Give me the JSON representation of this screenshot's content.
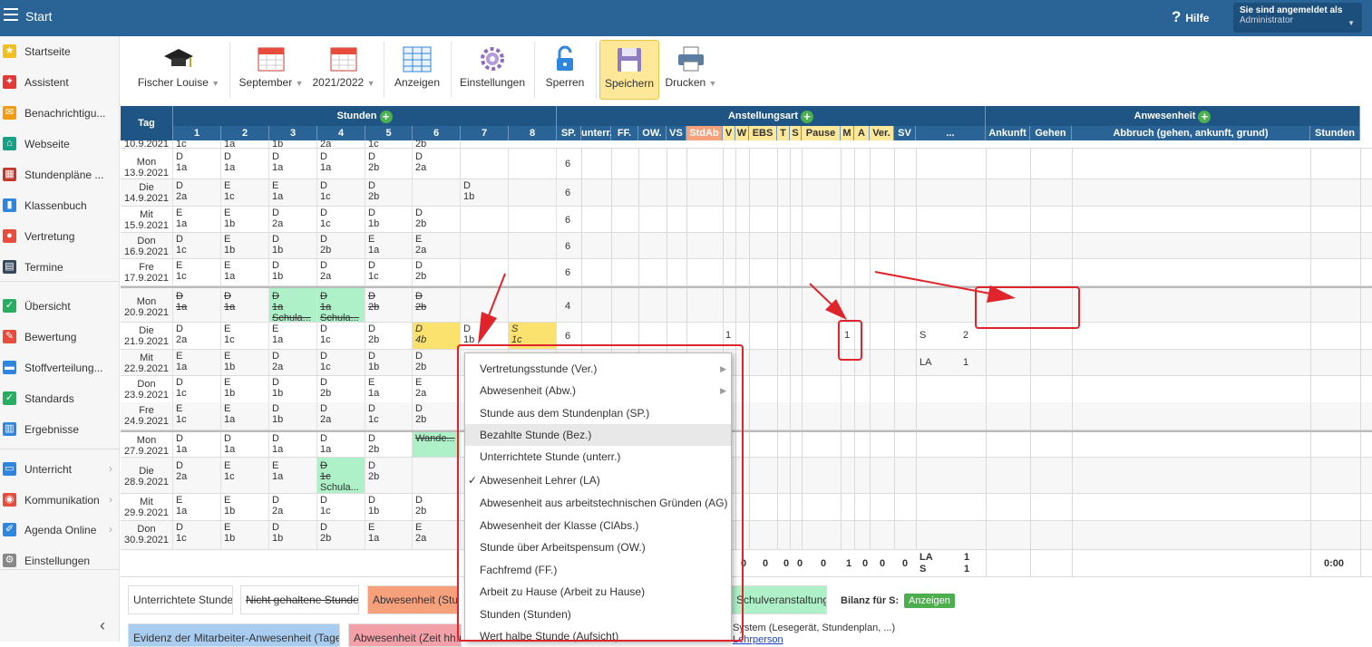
{
  "header": {
    "title": "Start",
    "help": "Hilfe",
    "user_label": "Sie sind angemeldet als",
    "user_role": "Administrator"
  },
  "sidebar": [
    {
      "label": "Startseite",
      "icon": "star-icon",
      "color": "#f0c020",
      "glyph": "★"
    },
    {
      "label": "Assistent",
      "icon": "wand-icon",
      "color": "#e53935",
      "glyph": "✦"
    },
    {
      "label": "Benachrichtigu...",
      "icon": "envelope-icon",
      "color": "#f39c12",
      "glyph": "✉"
    },
    {
      "label": "Webseite",
      "icon": "home-icon",
      "color": "#16a085",
      "glyph": "⌂"
    },
    {
      "label": "Stundenpläne ...",
      "icon": "timetable-icon",
      "color": "#c0392b",
      "glyph": "▦"
    },
    {
      "label": "Klassenbuch",
      "icon": "book-icon",
      "color": "#2e86de",
      "glyph": "▮"
    },
    {
      "label": "Vertretung",
      "icon": "person-icon",
      "color": "#e74c3c",
      "glyph": "●"
    },
    {
      "label": "Termine",
      "icon": "calendar-icon",
      "color": "#34495e",
      "glyph": "▤"
    },
    {
      "label": "Übersicht",
      "icon": "check-circle-icon",
      "color": "#27ae60",
      "glyph": "✓"
    },
    {
      "label": "Bewertung",
      "icon": "rating-icon",
      "color": "#e74c3c",
      "glyph": "✎"
    },
    {
      "label": "Stoffverteilung...",
      "icon": "briefcase-icon",
      "color": "#2e86de",
      "glyph": "▬"
    },
    {
      "label": "Standards",
      "icon": "shield-icon",
      "color": "#27ae60",
      "glyph": "✓"
    },
    {
      "label": "Ergebnisse",
      "icon": "bar-chart-icon",
      "color": "#2e86de",
      "glyph": "▥"
    },
    {
      "label": "Unterricht",
      "icon": "open-book-icon",
      "color": "#2e86de",
      "glyph": "▭"
    },
    {
      "label": "Kommunikation",
      "icon": "chat-icon",
      "color": "#e74c3c",
      "glyph": "◉"
    },
    {
      "label": "Agenda Online",
      "icon": "pen-icon",
      "color": "#2e86de",
      "glyph": "✐"
    },
    {
      "label": "Einstellungen",
      "icon": "gear-icon",
      "color": "#888888",
      "glyph": "⚙"
    }
  ],
  "toolbar": {
    "teacher": "Fischer Louise",
    "month": "September",
    "year": "2021/2022",
    "show": "Anzeigen",
    "settings": "Einstellungen",
    "lock": "Sperren",
    "save": "Speichern",
    "print": "Drucken"
  },
  "table": {
    "tag": "Tag",
    "stunden": "Stunden",
    "anstellungsart": "Anstellungsart",
    "anwesenheit": "Anwesenheit",
    "periods": [
      "1",
      "2",
      "3",
      "4",
      "5",
      "6",
      "7",
      "8"
    ],
    "ans_cols": [
      "SP.",
      "unterr.",
      "FF.",
      "OW.",
      "VS",
      "StdAb",
      "V",
      "W",
      "EBS",
      "T",
      "S",
      "Pause",
      "M",
      "A",
      "Ver.",
      "SV",
      "..."
    ],
    "anw_cols": [
      "Ankunft",
      "Gehen",
      "Abbruch (gehen, ankunft, grund)",
      "Stunden"
    ],
    "top_partial": {
      "date": "10.9.2021",
      "cells": [
        "1c",
        "1a",
        "1b",
        "2a",
        "1c",
        "2b"
      ]
    },
    "rows": [
      {
        "day": "Mon",
        "date": "13.9.2021",
        "sp": "6",
        "p": [
          [
            "D",
            "1a"
          ],
          [
            "D",
            "1a"
          ],
          [
            "D",
            "1a"
          ],
          [
            "D",
            "1a"
          ],
          [
            "D",
            "2b"
          ],
          [
            "D",
            "2a"
          ],
          [
            "",
            ""
          ],
          [
            "",
            ""
          ]
        ]
      },
      {
        "day": "Die",
        "date": "14.9.2021",
        "sp": "6",
        "p": [
          [
            "D",
            "2a"
          ],
          [
            "E",
            "1c"
          ],
          [
            "E",
            "1a"
          ],
          [
            "D",
            "1c"
          ],
          [
            "D",
            "2b"
          ],
          [
            "",
            ""
          ],
          [
            "D",
            "1b"
          ],
          [
            "",
            ""
          ]
        ]
      },
      {
        "day": "Mit",
        "date": "15.9.2021",
        "sp": "6",
        "p": [
          [
            "E",
            "1a"
          ],
          [
            "E",
            "1b"
          ],
          [
            "D",
            "2a"
          ],
          [
            "D",
            "1c"
          ],
          [
            "D",
            "1b"
          ],
          [
            "D",
            "2b"
          ],
          [
            "",
            ""
          ],
          [
            "",
            ""
          ]
        ]
      },
      {
        "day": "Don",
        "date": "16.9.2021",
        "sp": "6",
        "p": [
          [
            "D",
            "1c"
          ],
          [
            "E",
            "1b"
          ],
          [
            "D",
            "1b"
          ],
          [
            "D",
            "2b"
          ],
          [
            "E",
            "1a"
          ],
          [
            "E",
            "2a"
          ],
          [
            "",
            ""
          ],
          [
            "",
            ""
          ]
        ]
      },
      {
        "day": "Fre",
        "date": "17.9.2021",
        "sp": "6",
        "p": [
          [
            "E",
            "1c"
          ],
          [
            "E",
            "1a"
          ],
          [
            "D",
            "1b"
          ],
          [
            "D",
            "2a"
          ],
          [
            "D",
            "1c"
          ],
          [
            "D",
            "2b"
          ],
          [
            "",
            ""
          ],
          [
            "",
            ""
          ]
        ]
      },
      {
        "day": "Mon",
        "date": "20.9.2021",
        "sp": "4",
        "p": [
          [
            "D",
            "1a"
          ],
          [
            "D",
            "1a"
          ],
          [
            "D",
            "1a",
            "Schula..."
          ],
          [
            "D",
            "1a",
            "Schula..."
          ],
          [
            "D",
            "2b"
          ],
          [
            "D",
            "2b"
          ],
          [
            "",
            ""
          ],
          [
            "",
            ""
          ]
        ]
      },
      {
        "day": "Die",
        "date": "21.9.2021",
        "sp": "6",
        "p": [
          [
            "D",
            "2a"
          ],
          [
            "E",
            "1c"
          ],
          [
            "E",
            "1a"
          ],
          [
            "D",
            "1c"
          ],
          [
            "D",
            "2b"
          ],
          [
            "D",
            "4b"
          ],
          [
            "D",
            "1b"
          ],
          [
            "S",
            "1c"
          ]
        ],
        "v": "1",
        "m": "1",
        "dots": "S",
        "dots_n": "2"
      },
      {
        "day": "Mit",
        "date": "22.9.2021",
        "sp": "",
        "p": [
          [
            "E",
            "1a"
          ],
          [
            "E",
            "1b"
          ],
          [
            "D",
            "2a"
          ],
          [
            "D",
            "1c"
          ],
          [
            "D",
            "1b"
          ],
          [
            "D",
            "2b"
          ],
          [
            "",
            ""
          ],
          [
            "",
            ""
          ]
        ],
        "dots": "LA",
        "dots_n": "1"
      },
      {
        "day": "Don",
        "date": "23.9.2021",
        "sp": "",
        "p": [
          [
            "D",
            "1c"
          ],
          [
            "E",
            "1b"
          ],
          [
            "D",
            "1b"
          ],
          [
            "D",
            "2b"
          ],
          [
            "E",
            "1a"
          ],
          [
            "E",
            "2a"
          ],
          [
            "",
            ""
          ],
          [
            "",
            ""
          ]
        ]
      },
      {
        "day": "Fre",
        "date": "24.9.2021",
        "sp": "",
        "p": [
          [
            "E",
            "1c"
          ],
          [
            "E",
            "1a"
          ],
          [
            "D",
            "1b"
          ],
          [
            "D",
            "2a"
          ],
          [
            "D",
            "1c"
          ],
          [
            "D",
            "2b"
          ],
          [
            "",
            ""
          ],
          [
            "",
            ""
          ]
        ]
      },
      {
        "day": "Mon",
        "date": "27.9.2021",
        "sp": "",
        "p": [
          [
            "D",
            "1a"
          ],
          [
            "D",
            "1a"
          ],
          [
            "D",
            "1a"
          ],
          [
            "D",
            "1a"
          ],
          [
            "D",
            "2b"
          ],
          [
            "Wande...",
            ""
          ],
          [
            "",
            ""
          ],
          [
            "",
            ""
          ]
        ]
      },
      {
        "day": "Die",
        "date": "28.9.2021",
        "sp": "",
        "p": [
          [
            "D",
            "2a"
          ],
          [
            "E",
            "1c"
          ],
          [
            "E",
            "1a"
          ],
          [
            "D",
            "1c",
            "Schula..."
          ],
          [
            "D",
            "2b"
          ],
          [
            "",
            ""
          ],
          [
            "",
            ""
          ],
          [
            "",
            ""
          ]
        ]
      },
      {
        "day": "Mit",
        "date": "29.9.2021",
        "sp": "",
        "p": [
          [
            "E",
            "1a"
          ],
          [
            "E",
            "1b"
          ],
          [
            "D",
            "2a"
          ],
          [
            "D",
            "1c"
          ],
          [
            "D",
            "1b"
          ],
          [
            "D",
            "2b"
          ],
          [
            "",
            ""
          ],
          [
            "",
            ""
          ]
        ]
      },
      {
        "day": "Don",
        "date": "30.9.2021",
        "sp": "",
        "p": [
          [
            "D",
            "1c"
          ],
          [
            "E",
            "1b"
          ],
          [
            "D",
            "1b"
          ],
          [
            "D",
            "2b"
          ],
          [
            "E",
            "1a"
          ],
          [
            "E",
            "2a"
          ],
          [
            "",
            ""
          ],
          [
            "",
            ""
          ]
        ]
      }
    ],
    "totals": {
      "vals": [
        "0",
        "0",
        "0",
        "0",
        "0",
        "1",
        "0",
        "0",
        "0"
      ],
      "la": "LA",
      "s": "S",
      "la_n": "1",
      "s_n": "1",
      "hours": "0:00"
    }
  },
  "legend": {
    "unterrichtet": "Unterrichtete Stunde",
    "nicht": "Nicht gehaltene Stunde",
    "abw": "Abwesenheit (Stunc",
    "schulv": "Schulveranstaltung",
    "bilanz": "Bilanz für S:",
    "anzeigen": "Anzeigen",
    "evidenz": "Evidenz der Mitarbeiter-Anwesenheit (Tage)",
    "abw_zeit": "Abwesenheit (Zeit hh:m",
    "system": "System (Lesegerät, Stundenplan, ...)",
    "lehrperson": "Lehrperson"
  },
  "context_menu": [
    {
      "label": "Vertretungsstunde (Ver.)",
      "submenu": true
    },
    {
      "label": "Abwesenheit (Abw.)",
      "submenu": true
    },
    {
      "label": "Stunde aus dem Stundenplan (SP.)"
    },
    {
      "label": "Bezahlte Stunde (Bez.)",
      "highlight": true
    },
    {
      "label": "Unterrichtete Stunde (unterr.)"
    },
    {
      "label": "Abwesenheit Lehrer (LA)",
      "checked": true
    },
    {
      "label": "Abwesenheit aus arbeitstechnischen Gründen (AG)"
    },
    {
      "label": "Abwesenheit der Klasse (ClAbs.)"
    },
    {
      "label": "Stunde über Arbeitspensum (OW.)"
    },
    {
      "label": "Fachfremd (FF.)"
    },
    {
      "label": "Arbeit zu Hause (Arbeit zu Hause)"
    },
    {
      "label": "Stunden (Stunden)"
    },
    {
      "label": "Wert halbe Stunde (Aufsicht)"
    }
  ],
  "colors": {
    "header": "#2a6497",
    "accent_red": "#e0242b",
    "active": "#fde89a",
    "green": "#aef0c8",
    "yellow": "#fbe26e",
    "orange": "#f7a07c"
  }
}
